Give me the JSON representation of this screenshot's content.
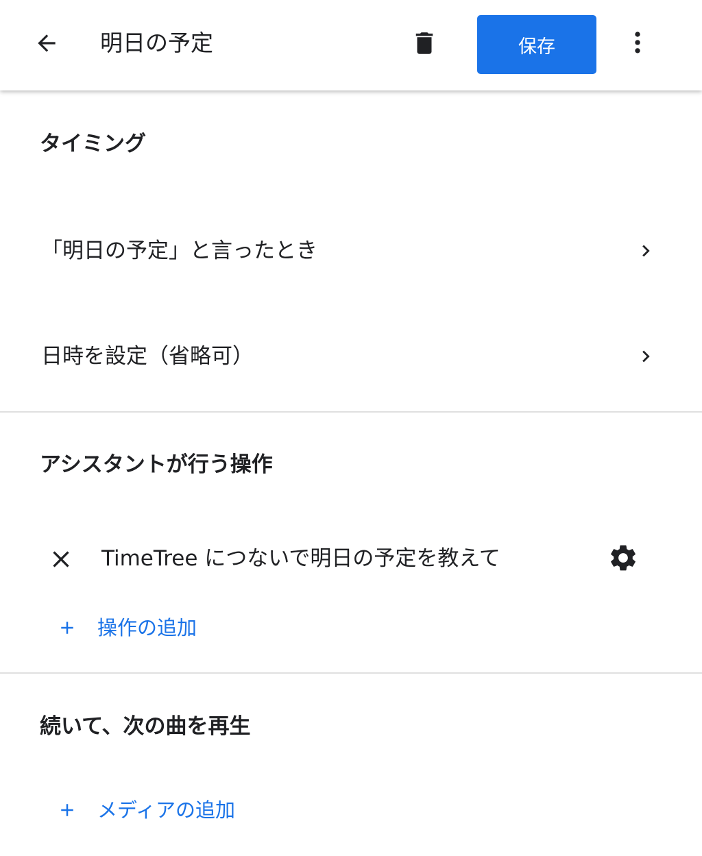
{
  "header": {
    "back_icon": "arrow-back-icon",
    "title": "明日の予定",
    "delete_icon": "trash-icon",
    "save_label": "保存",
    "more_icon": "more-vert-icon"
  },
  "timing": {
    "heading": "タイミング",
    "trigger_label": "「明日の予定」と言ったとき",
    "datetime_label": "日時を設定（省略可）"
  },
  "actions": {
    "heading": "アシスタントが行う操作",
    "items": [
      {
        "text": "TimeTree につないで明日の予定を教えて"
      }
    ],
    "add_label": "操作の追加"
  },
  "media": {
    "heading": "続いて、次の曲を再生",
    "add_label": "メディアの追加"
  },
  "colors": {
    "accent": "#1a73e8",
    "text": "#202124",
    "divider": "#e0e0e0"
  }
}
